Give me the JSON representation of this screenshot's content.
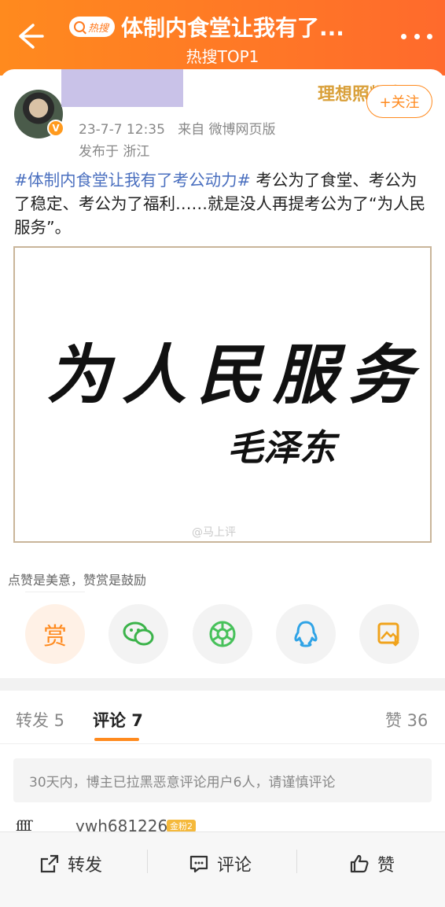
{
  "header": {
    "back_icon": "back-arrow-icon",
    "badge_label": "热搜",
    "title": "体制内食堂让我有了...",
    "subtitle": "热搜TOP1",
    "more_icon": "more-dots-icon",
    "background": "#ff7a24"
  },
  "post": {
    "brand_text": "理想照耀中国",
    "follow_label": "+关注",
    "timestamp": "23-7-7 12:35",
    "source": "来自 微博网页版",
    "location": "发布于 浙江",
    "hashtag": "#体制内食堂让我有了考公动力#",
    "body": " 考公为了食堂、考公为了稳定、考公为了福利……就是没人再提考公为了“为人民服务”。",
    "image_text": "为人民服务",
    "image_signature": "毛泽东",
    "image_watermark": "@马上评",
    "link_color": "#4a6fbf"
  },
  "reward": {
    "hint": "点赞是美意，赞赏是鼓励",
    "buttons": [
      {
        "name": "reward",
        "label": "赏"
      },
      {
        "name": "wechat",
        "icon": "wechat-icon"
      },
      {
        "name": "moments",
        "icon": "wechat-moments-icon"
      },
      {
        "name": "qq",
        "icon": "qq-icon"
      },
      {
        "name": "save-image",
        "icon": "save-image-icon"
      }
    ]
  },
  "tabs": {
    "repost": "转发 5",
    "comments": "评论 7",
    "likes": "赞 36"
  },
  "notice": "30天内，博主已拉黑恶意评论用户6人，请谨慎评论",
  "comment": {
    "username": "ywh681226",
    "badge": "金粉2"
  },
  "bottom_bar": {
    "repost": "转发",
    "comment": "评论",
    "like": "赞"
  }
}
